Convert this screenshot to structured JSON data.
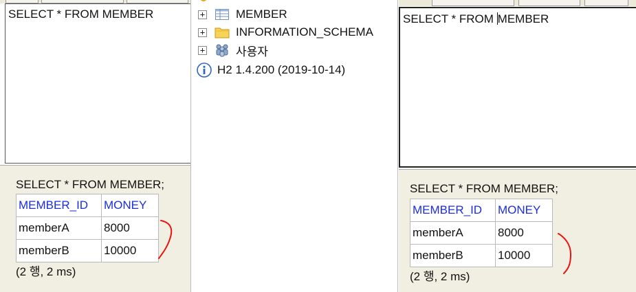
{
  "left_console": {
    "editor_sql": "SELECT * FROM MEMBER",
    "result_query": "SELECT * FROM MEMBER;",
    "columns": [
      "MEMBER_ID",
      "MONEY"
    ],
    "rows": [
      [
        "memberA",
        "8000"
      ],
      [
        "memberB",
        "10000"
      ]
    ],
    "footer": "(2 행, 2 ms)"
  },
  "tree": {
    "items": [
      {
        "label": "MEMBER",
        "icon": "table-icon"
      },
      {
        "label": "INFORMATION_SCHEMA",
        "icon": "folder-icon"
      },
      {
        "label": "사용자",
        "icon": "users-icon"
      }
    ],
    "version": "H2 1.4.200 (2019-10-14)"
  },
  "right_console": {
    "editor_sql_before_caret": "SELECT * FROM ",
    "editor_sql_after_caret": "MEMBER",
    "result_query": "SELECT * FROM MEMBER;",
    "columns": [
      "MEMBER_ID",
      "MONEY"
    ],
    "rows": [
      [
        "memberA",
        "8000"
      ],
      [
        "memberB",
        "10000"
      ]
    ],
    "footer": "(2 행, 2 ms)"
  },
  "colors": {
    "header_text": "#1a2ee0",
    "result_bg": "#f1efe2",
    "annotation": "#e11"
  }
}
